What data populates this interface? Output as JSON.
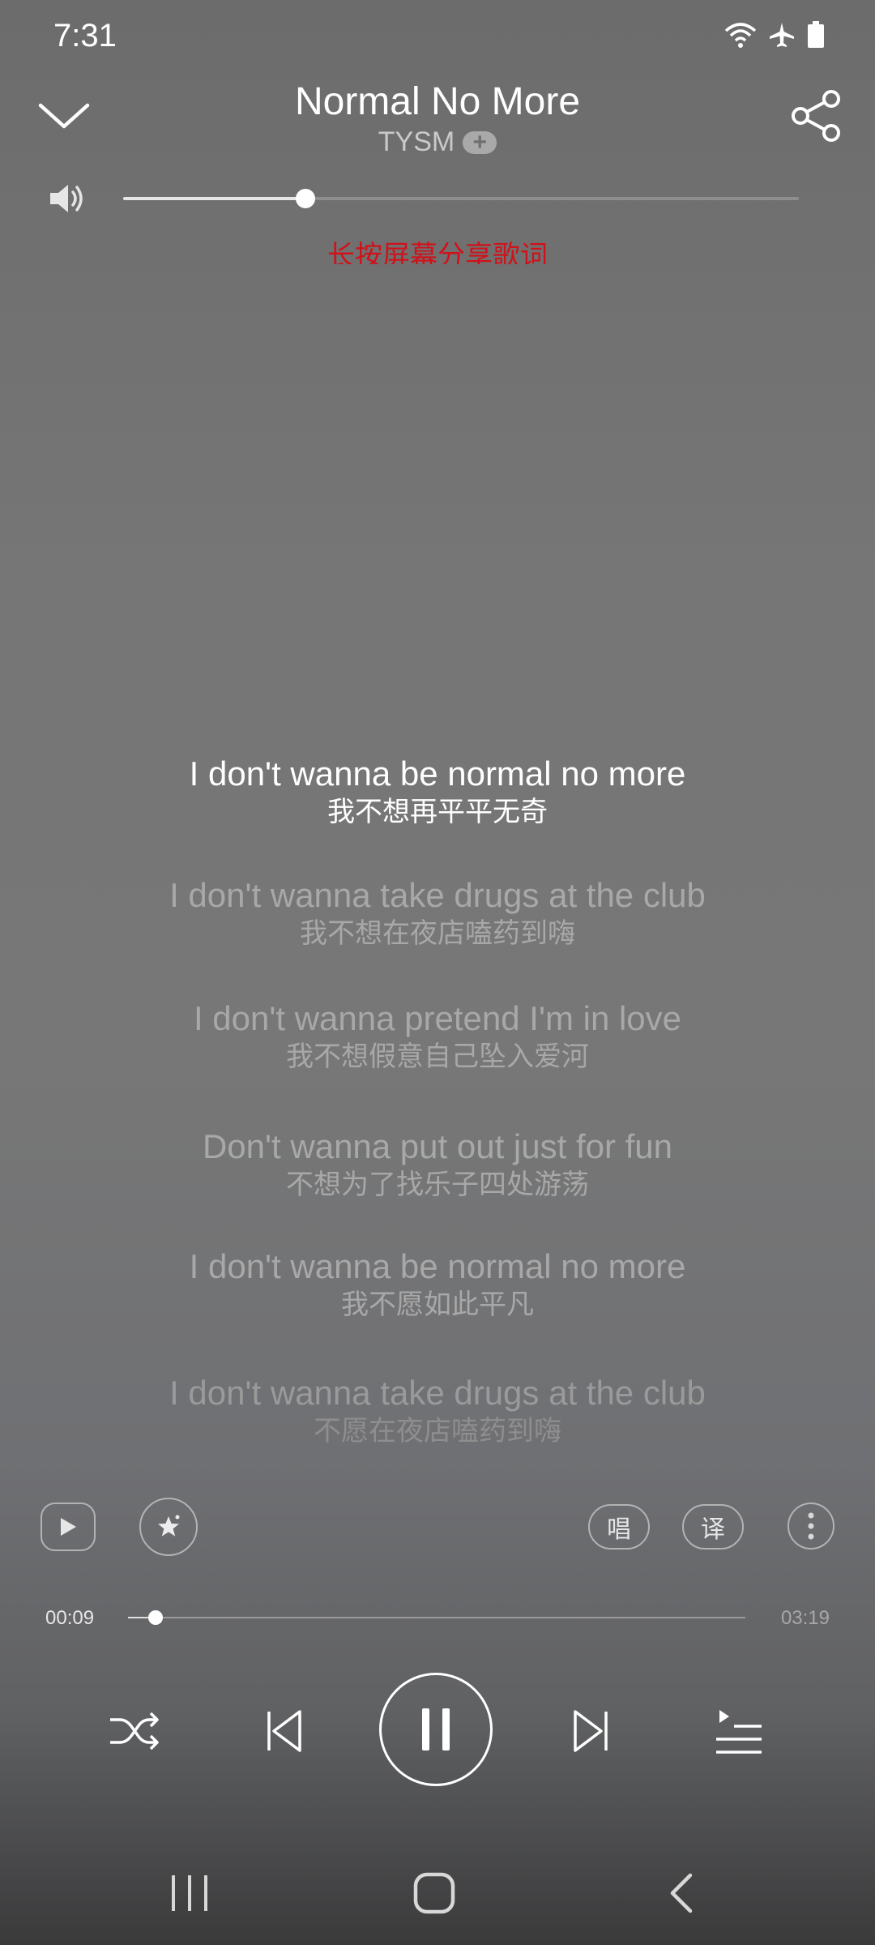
{
  "status_bar": {
    "time": "7:31",
    "icons": [
      "wifi-icon",
      "airplane-icon",
      "battery-icon"
    ]
  },
  "header": {
    "song_title": "Normal No More",
    "artist": "TYSM",
    "artist_follow_label": "+"
  },
  "volume": {
    "level_fraction": 0.27
  },
  "share_hint": "长按屏幕分享歌词",
  "lyrics": [
    {
      "en": "I don't wanna be normal no more",
      "zh": "我不想再平平无奇",
      "state": "current"
    },
    {
      "en": "I don't wanna take drugs at the club",
      "zh": "我不想在夜店嗑药到嗨",
      "state": "dim"
    },
    {
      "en": "I don't wanna pretend I'm in love",
      "zh": "我不想假意自己坠入爱河",
      "state": "dim"
    },
    {
      "en": "Don't wanna put out just for fun",
      "zh": "不想为了找乐子四处游荡",
      "state": "dim"
    },
    {
      "en": "I don't wanna be normal no more",
      "zh": "我不愿如此平凡",
      "state": "dim"
    },
    {
      "en": "I don't wanna take drugs at the club",
      "zh": "不愿在夜店嗑药到嗨",
      "state": "faint"
    }
  ],
  "actions": {
    "sing_label": "唱",
    "translate_label": "译"
  },
  "progress": {
    "elapsed": "00:09",
    "total": "03:19",
    "fraction": 0.045
  },
  "colors": {
    "share_hint": "#d0121a",
    "current_lyric": "#ffffff",
    "dim_lyric": "#a8a8a8"
  }
}
